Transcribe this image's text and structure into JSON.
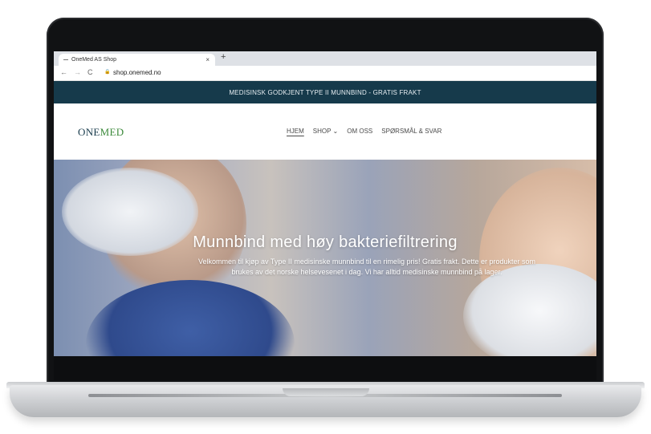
{
  "browser": {
    "tab_title": "OneMed AS Shop",
    "tab_close": "×",
    "new_tab": "+",
    "back": "←",
    "forward": "→",
    "reload": "C",
    "lock": "🔒",
    "url": "shop.onemed.no"
  },
  "site": {
    "announcement": "MEDISINSK GODKJENT TYPE II MUNNBIND - GRATIS FRAKT",
    "logo_one": "ONE",
    "logo_med": "MED",
    "nav": [
      "HJEM",
      "SHOP",
      "OM OSS",
      "SPØRSMÅL & SVAR"
    ],
    "shop_caret": "⌄",
    "hero_title": "Munnbind med høy bakteriefiltrering",
    "hero_text": "Velkommen til kjøp av Type II medisinske munnbind til en rimelig pris! Gratis frakt. Dette er produkter som brukes av det norske helsevesenet i dag. Vi har alltid medisinske munnbind på lager."
  },
  "colors": {
    "announcement_bg": "#163a4b",
    "logo_one": "#173a4b",
    "logo_med": "#3c8a3b"
  }
}
